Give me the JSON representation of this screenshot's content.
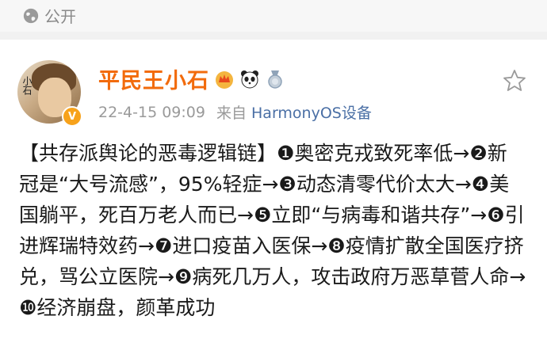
{
  "visibility": {
    "label": "公开",
    "icon": "globe-icon"
  },
  "post": {
    "author": "平民王小石",
    "timestamp": "22-4-15 09:09",
    "source_prefix": "来自",
    "source_device": "HarmonyOS设备",
    "verified_badge": "V",
    "avatar_text": "小石",
    "badges": [
      "crown-icon",
      "panda-icon",
      "medal-icon"
    ],
    "content": "【共存派舆论的恶毒逻辑链】❶奥密克戎致死率低→❷新冠是“大号流感”，95%轻症→❸动态清零代价太大→❹美国躺平，死百万老人而已→❺立即“与病毒和谐共存”→❻引进辉瑞特效药→❼进口疫苗入医保→❽疫情扩散全国医疗挤兑，骂公立医院→❾病死几万人，攻击政府万恶草菅人命→❿经济崩盘，颜革成功"
  },
  "colors": {
    "username": "#f26b0c",
    "meta": "#9a9a9a",
    "source_link": "#4a6fa5",
    "verified": "#f7a21b",
    "top_bar": "#f7f7f7"
  }
}
